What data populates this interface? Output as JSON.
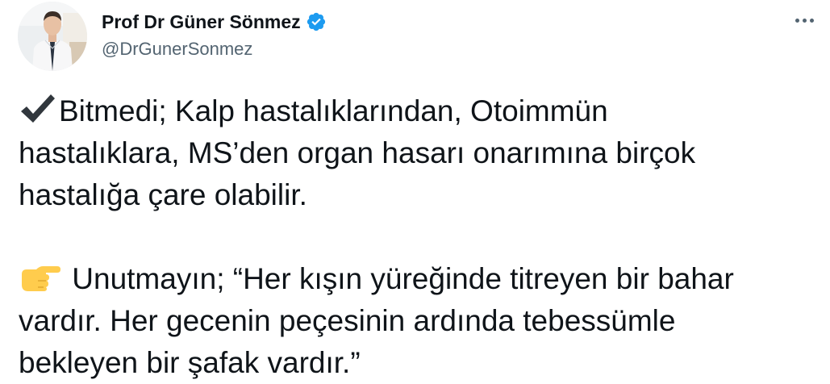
{
  "author": {
    "display_name": "Prof Dr Güner Sönmez",
    "handle": "@DrGunerSonmez",
    "verified": true,
    "avatar_icon": "profile-photo",
    "verified_color": "#1d9bf0"
  },
  "actions": {
    "more_icon": "more-horizontal-icon"
  },
  "tweet": {
    "paragraph1": {
      "emoji": "heavy-check-mark",
      "lines": [
        "Bitmedi; Kalp hastalıklarından, Otoimmün",
        "hastalıklara, MS’den organ hasarı onarımına birçok",
        "hastalığa çare olabilir."
      ]
    },
    "paragraph2": {
      "emoji": "backhand-index-pointing-right",
      "lines": [
        " Unutmayın; “Her kışın yüreğinde titreyen bir bahar",
        "vardır. Her gecenin peçesinin ardında tebessümle",
        "bekleyen bir şafak vardır.”"
      ]
    }
  },
  "colors": {
    "text": "#0f1419",
    "secondary": "#536471",
    "verified": "#1d9bf0"
  }
}
